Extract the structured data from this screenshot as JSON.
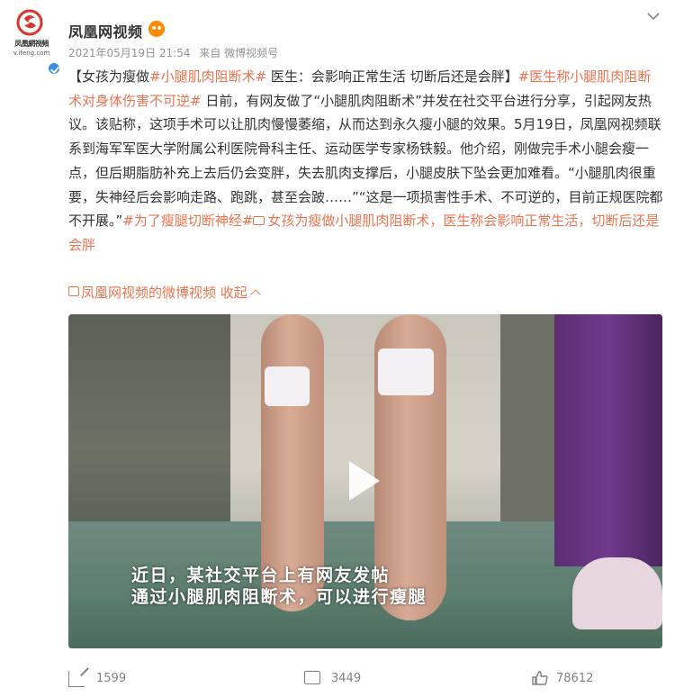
{
  "author": {
    "name": "凤凰网视频",
    "avatar_text": "凤凰網視頻",
    "avatar_url_text": "v.ifeng.com",
    "verified_icon": "verified-badge-icon",
    "vip_icon": "vip-face-icon"
  },
  "meta": {
    "timestamp": "2021年05月19日 21:54",
    "source": "来自 微博视频号"
  },
  "post": {
    "p1": "【女孩为瘦做",
    "tag1": "#小腿肌肉阻断术#",
    "p2": " 医生：会影响正常生活 切断后还是会胖】",
    "tag2": "#医生称小腿肌肉阻断术对身体伤害不可逆#",
    "p3": " 日前，有网友做了“小腿肌肉阻断术”并发在社交平台进行分享，引起网友热议。该贴称，这项手术可以让肌肉慢慢萎缩，从而达到永久瘦小腿的效果。5月19日，凤凰网视频联系到海军军医大学附属公利医院骨科主任、运动医学专家杨铁毅。他介绍，刚做完手术小腿会瘦一点，但后期脂肪补充上去后仍会变胖，失去肌肉支撑后，小腿皮肤下坠会更加难看。“小腿肌肉很重要，失神经后会影响走路、跑跳，甚至会跛……”“这是一项损害性手术、不可逆的，目前正规医院都不开展。”",
    "tag3": "#为了瘦腿切断神经#",
    "link_text": "女孩为瘦做小腿肌肉阻断术，医生称会影响正常生活，切断后还是会胖"
  },
  "video_source_link": "凤凰网视频的微博视频",
  "collapse_label": "收起",
  "video": {
    "caption_line1": "近日，某社交平台上有网友发帖",
    "caption_line2": "通过小腿肌肉阻断术，可以进行瘦腿"
  },
  "actions": {
    "share_count": "1599",
    "comment_count": "3449",
    "like_count": "78612"
  },
  "colors": {
    "link_accent": "#eb7350",
    "text": "#333333",
    "meta": "#939393"
  }
}
